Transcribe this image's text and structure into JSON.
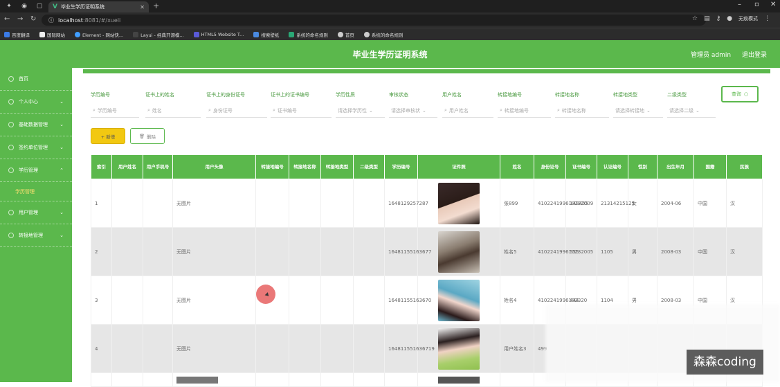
{
  "browser": {
    "tab_title": "毕业生学历证明系统",
    "url_host": "localhost",
    "url_rest": ":8081/#/xueli",
    "incognito": "无痕模式",
    "bookmarks": [
      "百度翻译",
      "国际网站",
      "Element - 网站快...",
      "Layui - 经典开源模...",
      "HTML5 Website T...",
      "搜索壁纸",
      "系统的命名规则",
      "首页",
      "系统的命名规则"
    ]
  },
  "header": {
    "title": "毕业生学历证明系统",
    "admin": "管理员 admin",
    "logout": "退出登录"
  },
  "sidebar": {
    "items": [
      {
        "label": "首页",
        "chev": ""
      },
      {
        "label": "个人中心",
        "chev": "⌄"
      },
      {
        "label": "基础数据管理",
        "chev": "⌄"
      },
      {
        "label": "签约单位管理",
        "chev": "⌄"
      },
      {
        "label": "学历管理",
        "chev": "⌃"
      },
      {
        "label": "用户管理",
        "chev": "⌄"
      },
      {
        "label": "转接地管理",
        "chev": "⌄"
      }
    ],
    "active_sub": "学历管理"
  },
  "filters": [
    {
      "label": "学历编号",
      "placeholder": "学历编号",
      "icon": "search"
    },
    {
      "label": "证书上的姓名",
      "placeholder": "姓名",
      "icon": "search"
    },
    {
      "label": "证书上的身份证号",
      "placeholder": "身份证号",
      "icon": "search"
    },
    {
      "label": "证书上的证书编号",
      "placeholder": "证书编号",
      "icon": "search"
    },
    {
      "label": "学历性质",
      "placeholder": "请选择学历性",
      "icon": "select"
    },
    {
      "label": "审核状态",
      "placeholder": "请选择审核状",
      "icon": "select"
    },
    {
      "label": "用户姓名",
      "placeholder": "用户姓名",
      "icon": "search"
    },
    {
      "label": "转接地编号",
      "placeholder": "转接地编号",
      "icon": "search"
    },
    {
      "label": "转接地名称",
      "placeholder": "转接地名称",
      "icon": "search"
    },
    {
      "label": "转接地类型",
      "placeholder": "请选择转接地",
      "icon": "select"
    },
    {
      "label": "二级类型",
      "placeholder": "请选择二级",
      "icon": "select"
    }
  ],
  "buttons": {
    "query": "查询",
    "add": "+ 新增",
    "delete": "删除"
  },
  "table": {
    "headers": [
      "索引",
      "用户姓名",
      "用户手机号",
      "用户头像",
      "转接地编号",
      "转接地名称",
      "转接地类型",
      "二级类型",
      "学历编号",
      "证件照",
      "姓名",
      "身份证号",
      "证书编号",
      "认证编号",
      "性别",
      "出生年月",
      "国籍",
      "民族"
    ],
    "rows": [
      {
        "index": "1",
        "avatar": "无图片",
        "xueli_no": "1648129257287",
        "name": "张899",
        "id_no": "410224199610232009",
        "cert_no": "148455",
        "auth_no": "21314215125",
        "gender": "女",
        "birth": "2004-06",
        "nation": "中国",
        "ethnic": "汉"
      },
      {
        "index": "2",
        "avatar": "无图片",
        "xueli_no": "16481155163677",
        "name": "姓名5",
        "id_no": "410224199610232005",
        "cert_no": "555",
        "auth_no": "1105",
        "gender": "男",
        "birth": "2008-03",
        "nation": "中国",
        "ethnic": "汉"
      },
      {
        "index": "3",
        "avatar": "无图片",
        "xueli_no": "16481155163670",
        "name": "姓名4",
        "id_no": "4102241996102320",
        "cert_no": "444",
        "auth_no": "1104",
        "gender": "男",
        "birth": "2008-03",
        "nation": "中国",
        "ethnic": "汉"
      },
      {
        "index": "4",
        "avatar": "无图片",
        "xueli_no": "164811551636719",
        "name": "用户姓名3",
        "id_no": "499",
        "cert_no": "",
        "auth_no": "",
        "gender": "",
        "birth": "",
        "nation": "",
        "ethnic": ""
      }
    ]
  },
  "watermark": "森森coding"
}
